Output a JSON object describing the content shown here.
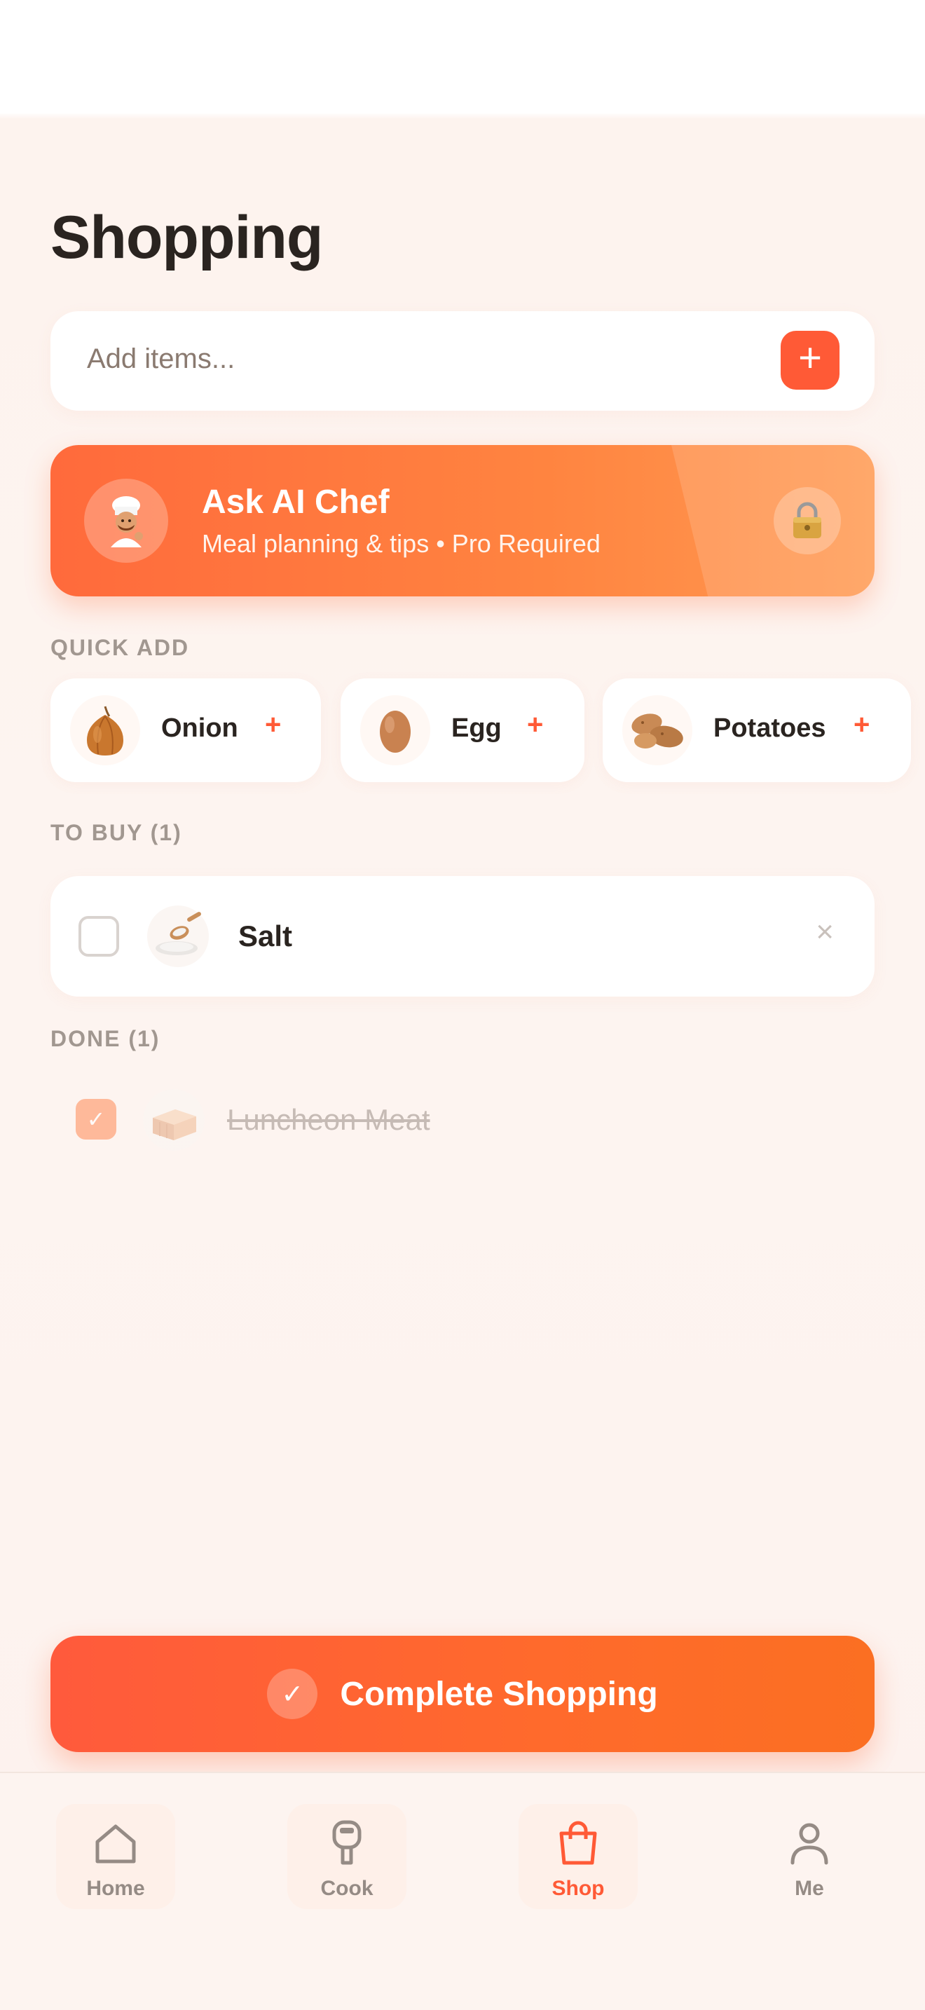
{
  "page": {
    "title": "Shopping"
  },
  "add_bar": {
    "placeholder": "Add items...",
    "add_icon": "plus-icon"
  },
  "ai_card": {
    "title": "Ask AI Chef",
    "subtitle": "Meal planning & tips • Pro Required",
    "avatar_icon": "chef-icon",
    "lock_icon": "lock-icon"
  },
  "quick_add": {
    "label": "QUICK ADD",
    "items": [
      {
        "label": "Onion",
        "icon": "onion-icon"
      },
      {
        "label": "Egg",
        "icon": "egg-icon"
      },
      {
        "label": "Potatoes",
        "icon": "potatoes-icon"
      }
    ]
  },
  "to_buy": {
    "label": "TO BUY (1)",
    "items": [
      {
        "name": "Salt",
        "checked": false,
        "icon": "salt-icon"
      }
    ]
  },
  "done": {
    "label": "DONE (1)",
    "items": [
      {
        "name": "Luncheon Meat",
        "checked": true,
        "icon": "luncheon-meat-icon"
      }
    ]
  },
  "complete_button": {
    "label": "Complete Shopping"
  },
  "tabbar": {
    "active": "Shop",
    "accent": "#ff5a36",
    "tabs": [
      {
        "label": "Home",
        "icon": "home-icon"
      },
      {
        "label": "Cook",
        "icon": "cook-icon"
      },
      {
        "label": "Shop",
        "icon": "shopping-bag-icon"
      },
      {
        "label": "Me",
        "icon": "person-icon"
      }
    ]
  },
  "colors": {
    "primary": "#ff5a36",
    "background": "#fdf4f0",
    "text": "#2a2420",
    "muted": "#a19790"
  }
}
